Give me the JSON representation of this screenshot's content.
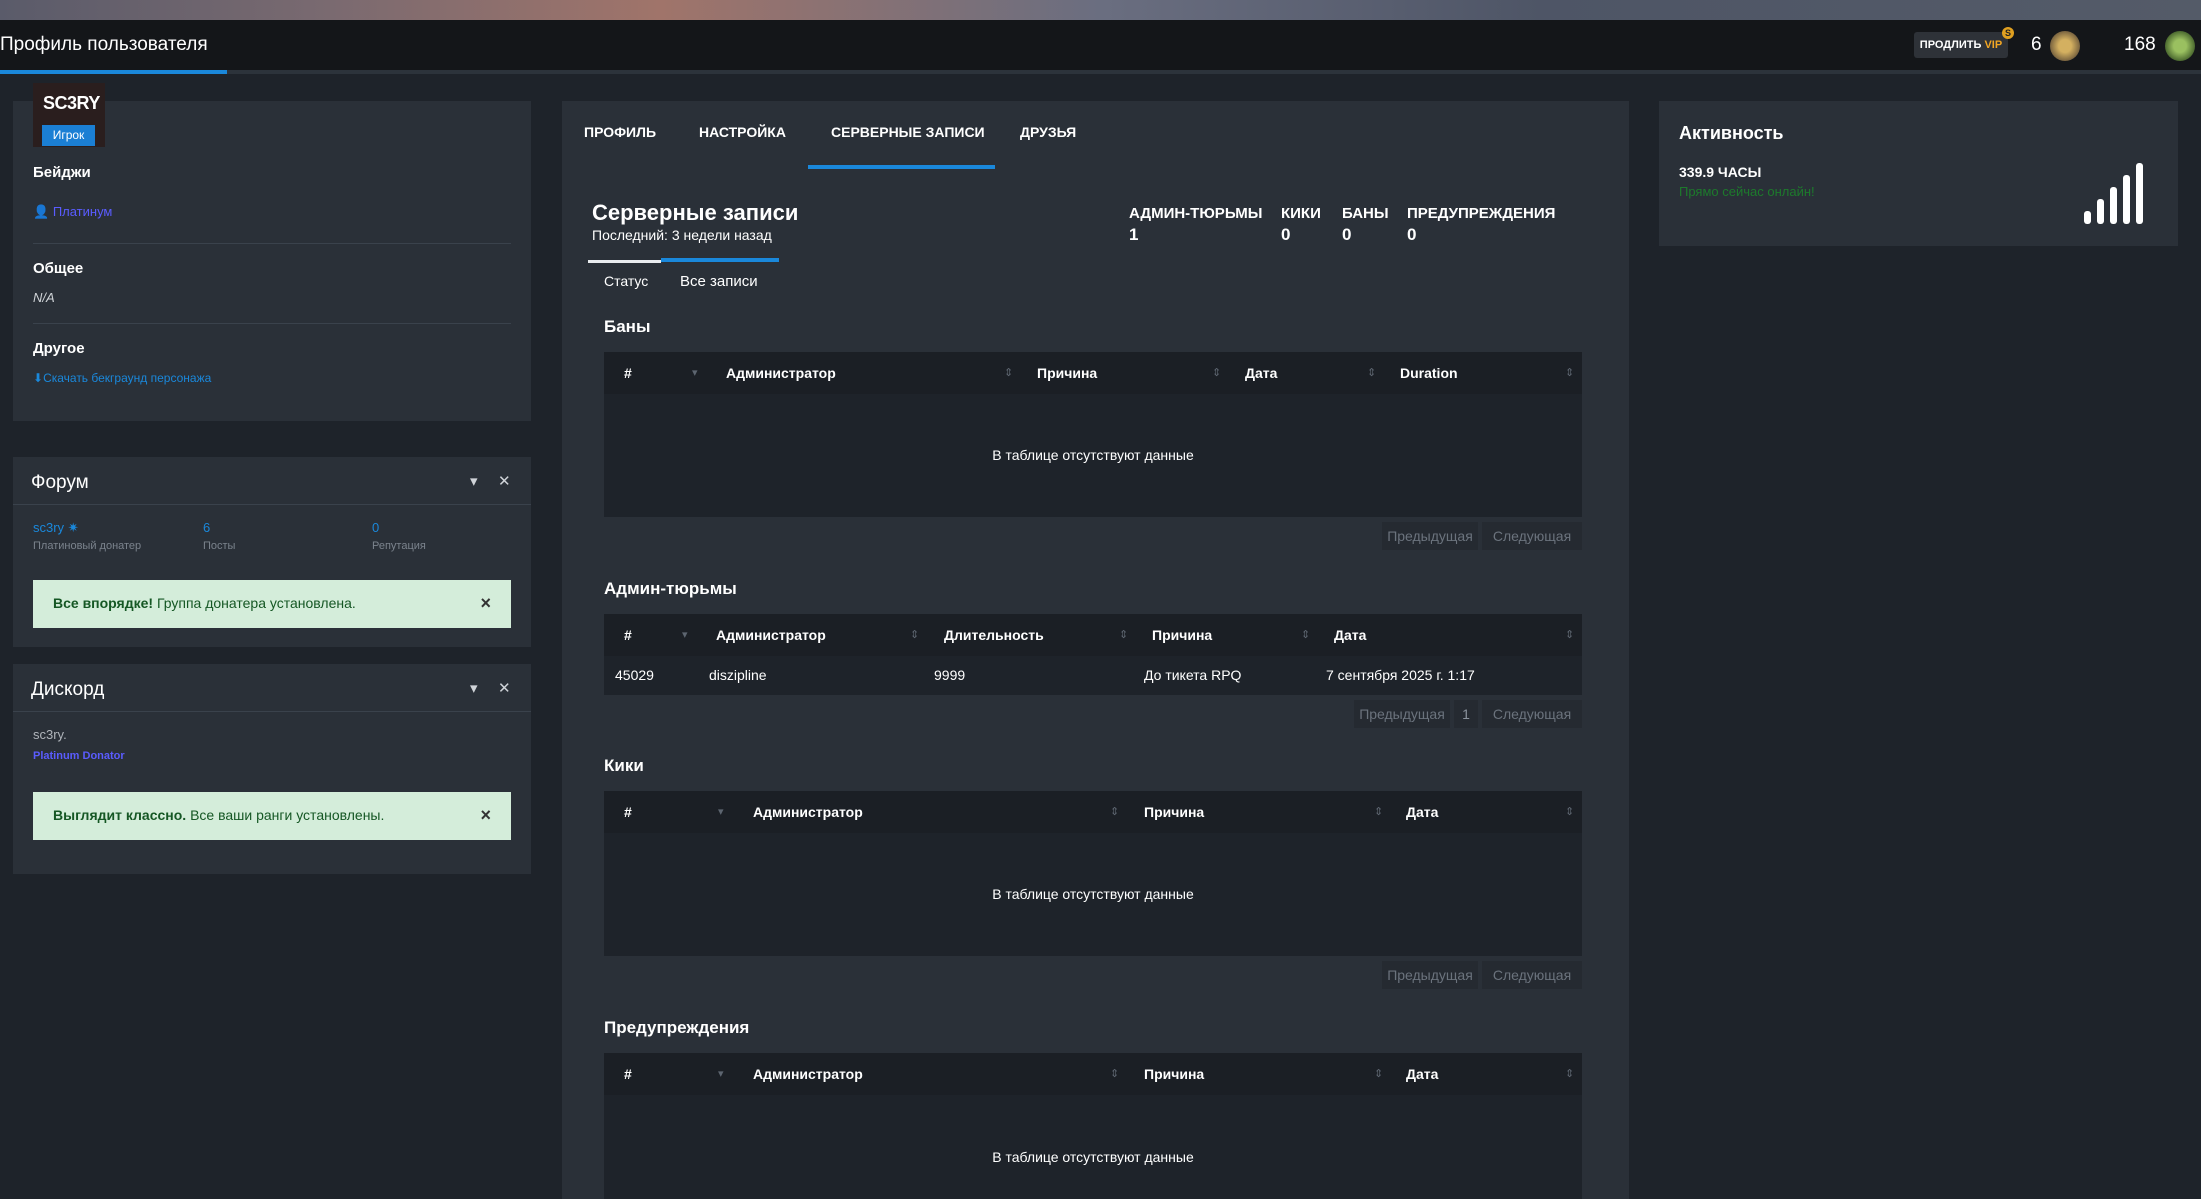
{
  "header": {
    "page_title": "Профиль пользователя",
    "vip_button_prefix": "ПРОДЛИТЬ",
    "vip_button_suffix": "VIP",
    "vip_badge": "S",
    "count_left": "6",
    "count_right": "168"
  },
  "profile": {
    "username": "SC3RY",
    "role": "Игрок",
    "badges_title": "Бейджи",
    "badge_name": "Платинум",
    "general_title": "Общее",
    "general_value": "N/A",
    "other_title": "Другое",
    "download_link": "Скачать бекграунд персонажа"
  },
  "forum": {
    "title": "Форум",
    "user": "sc3ry",
    "user_caption": "Платиновый донатер",
    "posts_value": "6",
    "posts_caption": "Посты",
    "rep_value": "0",
    "rep_caption": "Репутация",
    "alert_strong": "Все впорядке!",
    "alert_text": " Группа донатера установлена."
  },
  "discord": {
    "title": "Дискорд",
    "user": "sc3ry.",
    "rank": "Platinum Donator",
    "alert_strong": "Выглядит классно.",
    "alert_text": " Все ваши ранги установлены."
  },
  "tabs": [
    "ПРОФИЛЬ",
    "НАСТРОЙКА",
    "СЕРВЕРНЫЕ ЗАПИСИ",
    "ДРУЗЬЯ"
  ],
  "records": {
    "title": "Серверные записи",
    "last": "Последний: 3 недели назад",
    "stats": [
      {
        "label": "АДМИН-ТЮРЬМЫ",
        "value": "1"
      },
      {
        "label": "КИКИ",
        "value": "0"
      },
      {
        "label": "БАНЫ",
        "value": "0"
      },
      {
        "label": "ПРЕДУПРЕЖДЕНИЯ",
        "value": "0"
      }
    ],
    "subtabs": [
      "Статус",
      "Все записи"
    ]
  },
  "bans": {
    "title": "Баны",
    "columns": [
      "#",
      "Администратор",
      "Причина",
      "Дата",
      "Duration"
    ],
    "empty": "В таблице отсутствуют данные",
    "prev": "Предыдущая",
    "next": "Следующая"
  },
  "jails": {
    "title": "Админ-тюрьмы",
    "columns": [
      "#",
      "Администратор",
      "Длительность",
      "Причина",
      "Дата"
    ],
    "rows": [
      [
        "45029",
        "diszipline",
        "9999",
        "До тикета RPQ",
        "7 сентября 2025 г. 1:17"
      ]
    ],
    "prev": "Предыдущая",
    "page": "1",
    "next": "Следующая"
  },
  "kicks": {
    "title": "Кики",
    "columns": [
      "#",
      "Администратор",
      "Причина",
      "Дата"
    ],
    "empty": "В таблице отсутствуют данные",
    "prev": "Предыдущая",
    "next": "Следующая"
  },
  "warnings": {
    "title": "Предупреждения",
    "columns": [
      "#",
      "Администратор",
      "Причина",
      "Дата"
    ],
    "empty": "В таблице отсутствуют данные"
  },
  "activity": {
    "title": "Активность",
    "hours": "339.9 ЧАСЫ",
    "online": "Прямо сейчас онлайн!"
  },
  "colors": {
    "accent": "#1a88db",
    "background": "#1e232a",
    "panel": "#2a3038",
    "success_bg": "#d4edda",
    "online_green": "#1d7a2c"
  }
}
